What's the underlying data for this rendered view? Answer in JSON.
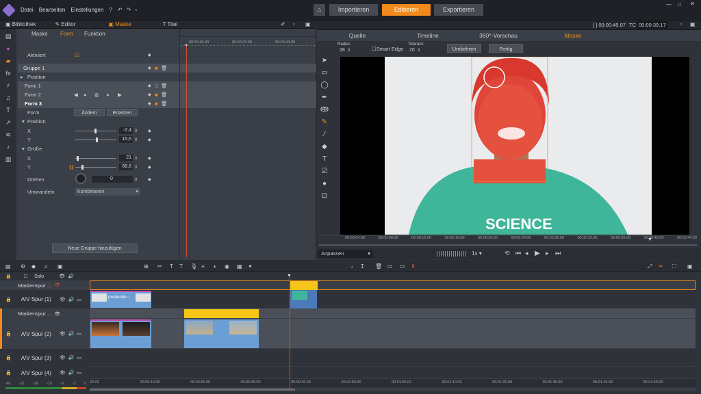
{
  "menu": [
    "Datei",
    "Bearbeiten",
    "Einstellungen"
  ],
  "main_tabs": {
    "import": "Importieren",
    "edit": "Editieren",
    "export": "Exportieren"
  },
  "left_tabs": {
    "library": "Bibliothek",
    "editor": "Editor",
    "mask": "Maske",
    "title": "Titel"
  },
  "sub_tabs": {
    "mask": "Maske",
    "form": "Form",
    "function": "Funktion"
  },
  "ruler_top": [
    "00:00:40.00",
    "00:00:42.00",
    "00:00:44.00"
  ],
  "props": {
    "activated": "Aktiviert",
    "group1": "Gruppe 1",
    "position": "Position",
    "form1": "Form 1",
    "form2": "Form 2",
    "form3": "Form 3",
    "form": "Form",
    "change": "Ändern",
    "replace": "Ersetzen",
    "position2": "Position",
    "x": "X",
    "y": "Y",
    "x_val": "-2,4",
    "y_val": "15,6",
    "size": "Größe",
    "sx": "X",
    "sy": "Y",
    "sx_val": "21",
    "sy_val": "68,8",
    "rotate": "Drehen",
    "rotate_val": "0",
    "convert": "Umwandeln",
    "convert_val": "Kombinieren",
    "add_group": "Neue Gruppe hinzufügen"
  },
  "right_tabs": {
    "source": "Quelle",
    "timeline": "Timeline",
    "vr": "360°-Vorschau",
    "mask": "Maske"
  },
  "timecode": {
    "dur": "[ ] 00:00:45.07",
    "tc_label": "TC",
    "tc": "00:00:39.17"
  },
  "mask_tools": {
    "radius_label": "Radius",
    "radius": "28",
    "smart_edge": "Smart Edge",
    "tolerance_label": "Toleranz",
    "tolerance": "20",
    "invert": "Umkehren",
    "done": "Fertig"
  },
  "video_shirt": "SCIENCE",
  "scrub_ticks": [
    "00:00:04.00",
    "00:00:08.00",
    "00:00:12.00",
    "00:00:16.00",
    "00:00:20.00",
    "00:00:24.00",
    "00:00:28.00",
    "00:00:32.00",
    "00:00:36.00",
    "00:00:40.00",
    "00:00:44.00"
  ],
  "vctrl": {
    "fit": "Anpassen",
    "speed": "1x"
  },
  "tracks": {
    "solo": "Solo",
    "mask1": "Maskenspur ...",
    "av1": "A/V Spur (1)",
    "mask2": "Maskenspur ...",
    "av2": "A/V Spur (2)",
    "av3": "A/V Spur (3)",
    "av4": "A/V Spur (4)",
    "clip_label": "productio..."
  },
  "tl_ruler": [
    "00:00",
    "00:00:10.00",
    "00:00:20.00",
    "00:00:30.00",
    "00:00:40.00",
    "00:00:50.00",
    "00:01:00.00",
    "00:01:10.00",
    "00:01:20.00",
    "00:01:30.00",
    "00:01:40.00",
    "00:01:50.00"
  ],
  "meter": [
    "-60",
    "-22",
    "-16",
    "-10",
    "-6",
    "-3",
    "0"
  ],
  "colors": {
    "accent": "#f08a1c",
    "mask_red": "#e0453a",
    "shirt": "#3fb59a",
    "clip": "#6c9ed6",
    "mask_clip": "#f5c518"
  }
}
